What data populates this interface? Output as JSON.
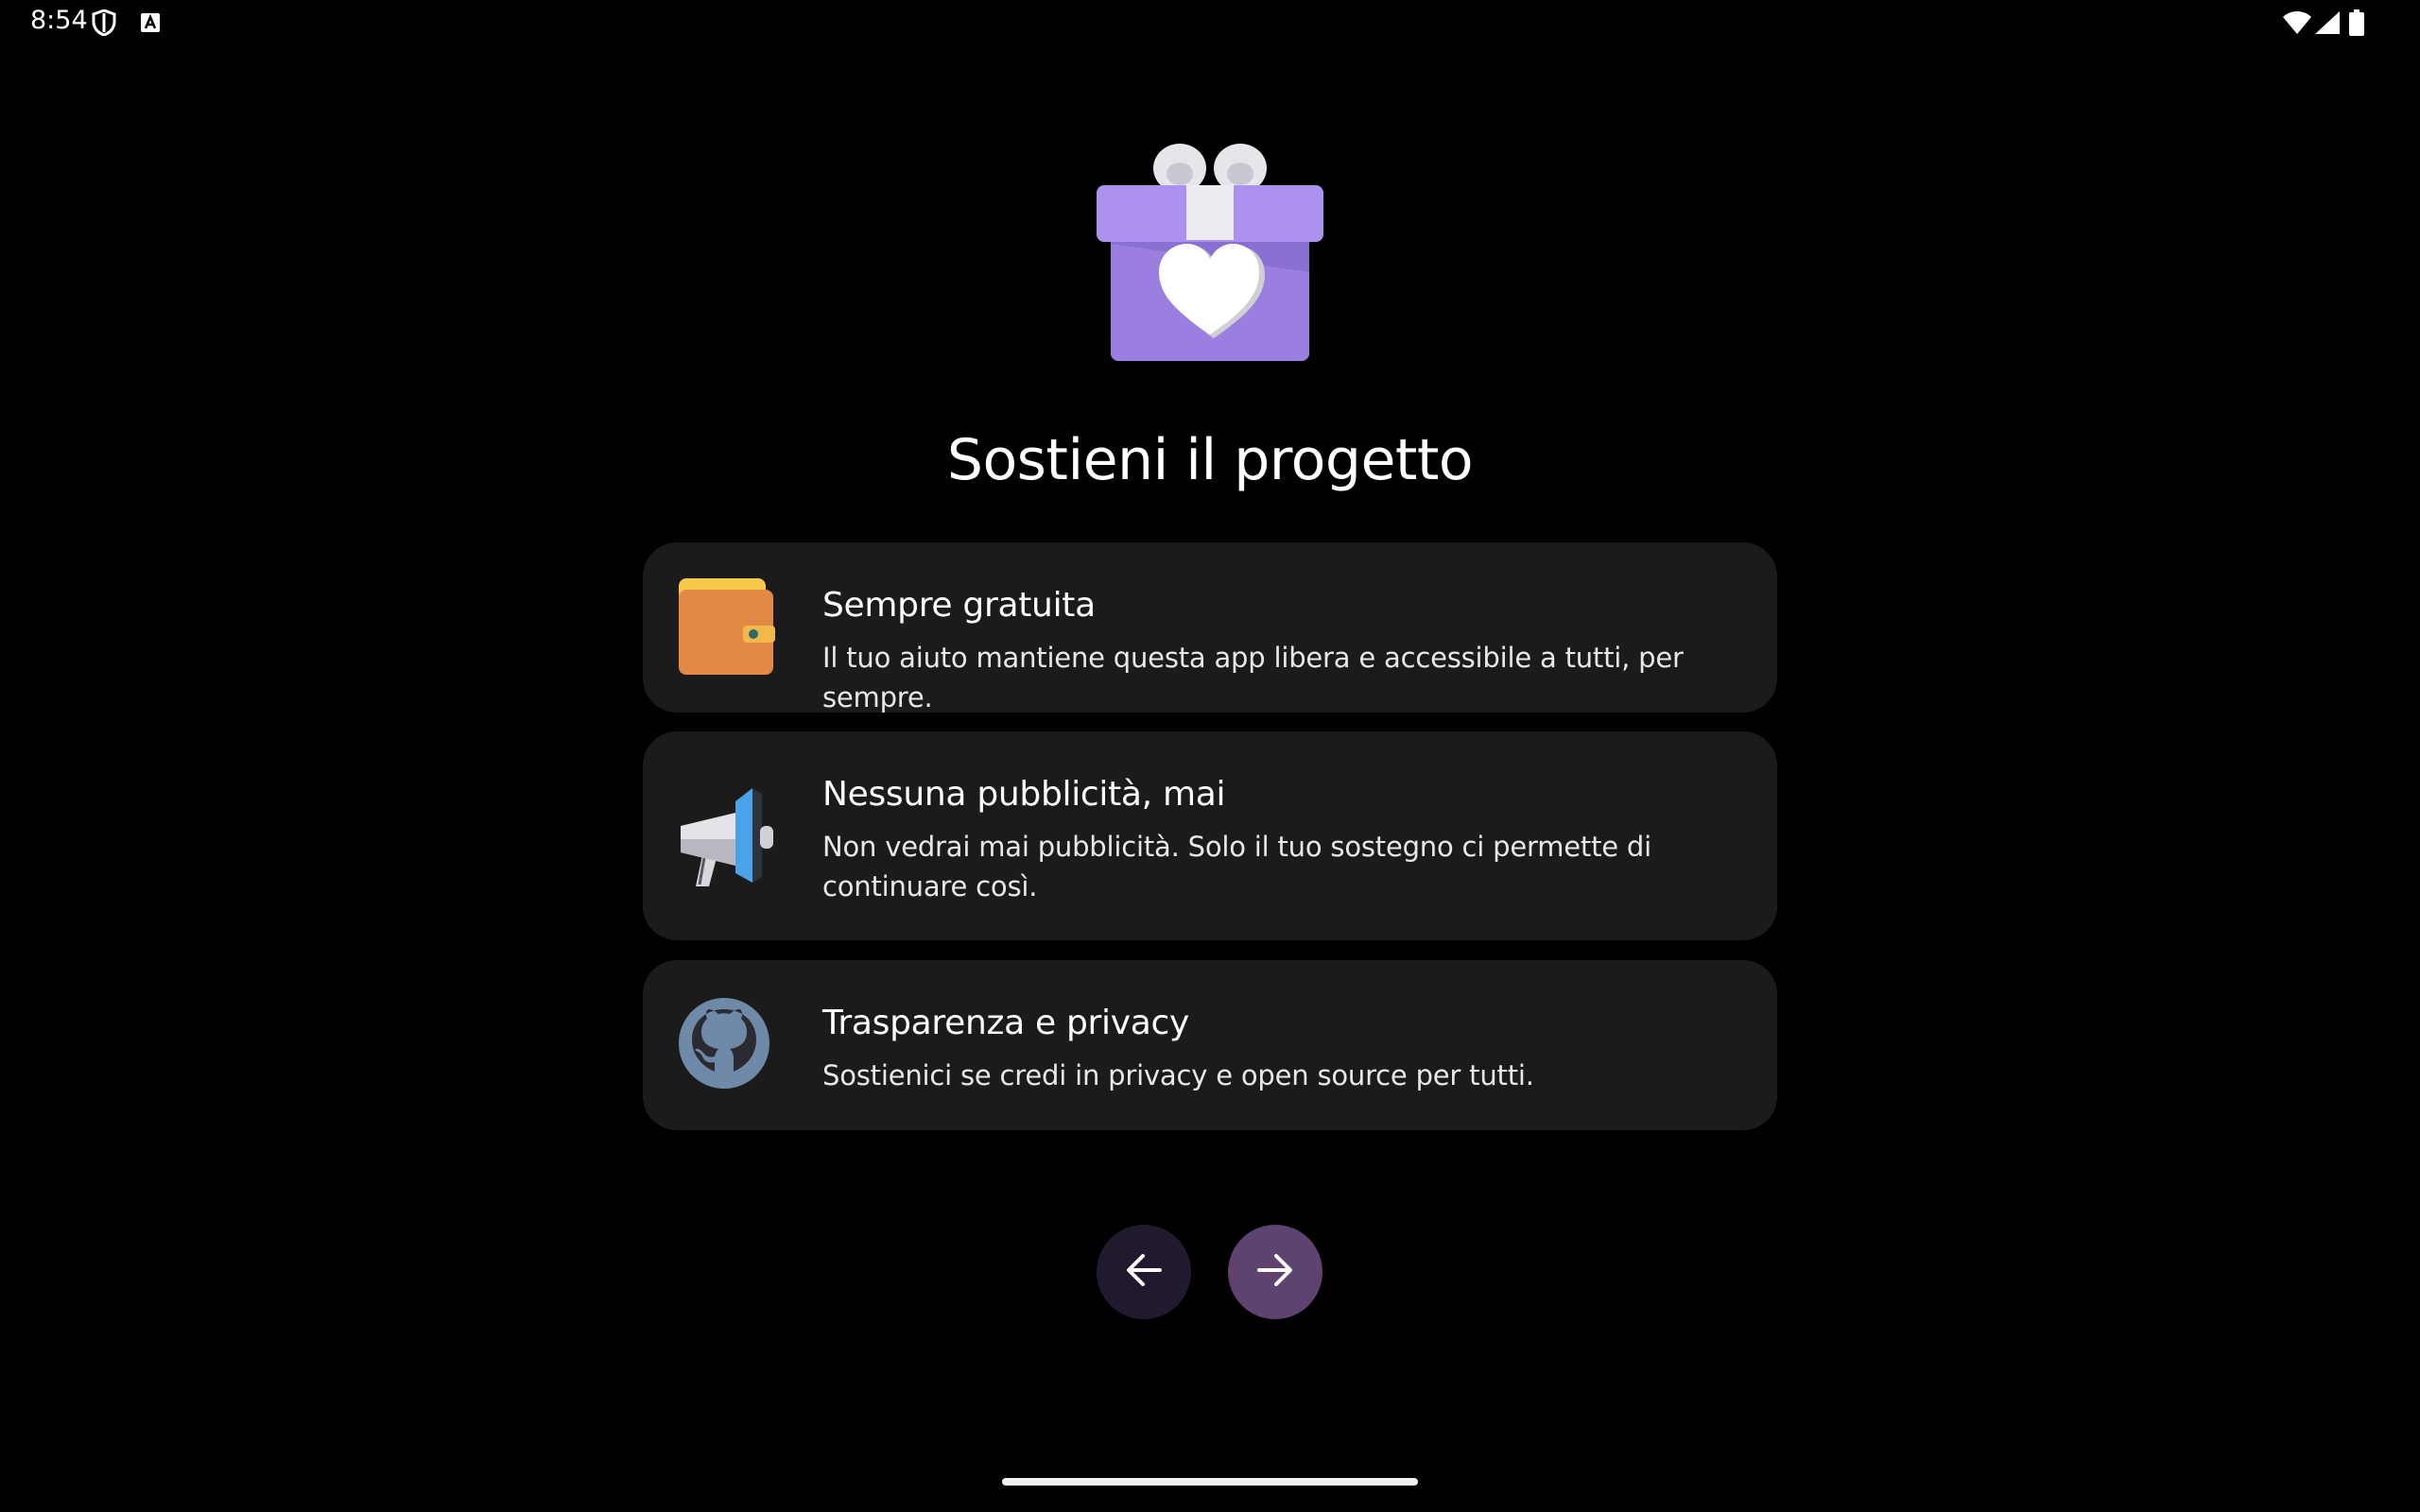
{
  "status_bar": {
    "time": "8:54"
  },
  "page": {
    "title": "Sostieni il progetto"
  },
  "cards": [
    {
      "title": "Sempre gratuita",
      "description": "Il tuo aiuto mantiene questa app libera e accessibile a tutti, per sempre.",
      "icon": "wallet-icon"
    },
    {
      "title": "Nessuna pubblicità, mai",
      "description": "Non vedrai mai pubblicità. Solo il tuo sostegno ci permette di continuare così.",
      "icon": "megaphone-icon"
    },
    {
      "title": "Trasparenza e privacy",
      "description": "Sostienici se credi in privacy e open source per tutti.",
      "icon": "github-icon"
    }
  ],
  "navigation": {
    "back_icon": "arrow-left-icon",
    "next_icon": "arrow-right-icon"
  },
  "colors": {
    "background": "#000000",
    "card": "#1b1b1b",
    "back_button": "#211a2e",
    "next_button": "#5e4270",
    "gift": "#9b80e0"
  }
}
